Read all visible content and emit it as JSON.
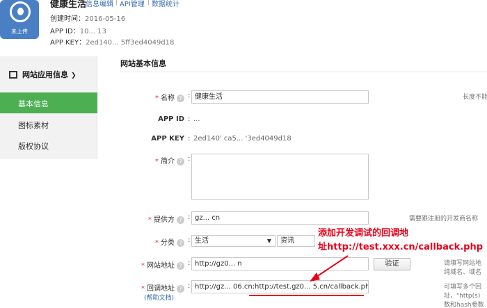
{
  "header": {
    "app_name": "健康生活",
    "links": [
      "信息编辑",
      "API管理",
      "数据统计"
    ],
    "separator": "|",
    "created_label": "创建时间：",
    "created_value": "2016-05-16",
    "appid_label": "APP ID：",
    "appid_value": "10...      13",
    "appkey_label": "APP KEY：",
    "appkey_value": "2ed140...                       5ff3ed4049d18",
    "avatar_caption": "未上传"
  },
  "sidebar": {
    "heading": "网站应用信息",
    "items": [
      {
        "label": "基本信息",
        "selected": true
      },
      {
        "label": "图标素材",
        "selected": false
      },
      {
        "label": "版权协议",
        "selected": false
      }
    ]
  },
  "main": {
    "section_title": "网站基本信息",
    "question_mark": "?",
    "colon": ":",
    "name": {
      "label": "名称",
      "value": "健康生活",
      "hint": "长度不能"
    },
    "app_id": {
      "label": "APP ID",
      "value": "..."
    },
    "app_key": {
      "label": "APP KEY",
      "value": "2ed140'            ca5...           '3ed4049d18"
    },
    "intro": {
      "label": "简介",
      "value": ""
    },
    "provider": {
      "label": "提供方",
      "value": "gz...        cn",
      "hint": "需要跟注册的开发商名称"
    },
    "category": {
      "label": "分类",
      "value1": "生活",
      "value2": "资讯",
      "caret": "▼"
    },
    "site_url": {
      "label": "网站地址",
      "value": "http://gz0...     n",
      "verify_label": "验证",
      "hint1": "请填写网站地",
      "hint2": "纯域名、域名"
    },
    "callback_url": {
      "label": "回调地址",
      "value": "http://gz...   06.cn;http://test.gz0...   5.cn/callback.php",
      "help_link": "(帮助文档)",
      "hint1": "可填写多个回",
      "hint2": "址，\"http(s)",
      "hint3": "数和hash参数"
    }
  },
  "annotation": {
    "line1": "添加开发调试的回调地",
    "line2": "址http://test.xxx.cn/callback.php",
    "color": "#e8001a"
  },
  "colors": {
    "accent_green": "#4caf52",
    "link_blue": "#3a6fb0",
    "required_red": "#e23"
  }
}
